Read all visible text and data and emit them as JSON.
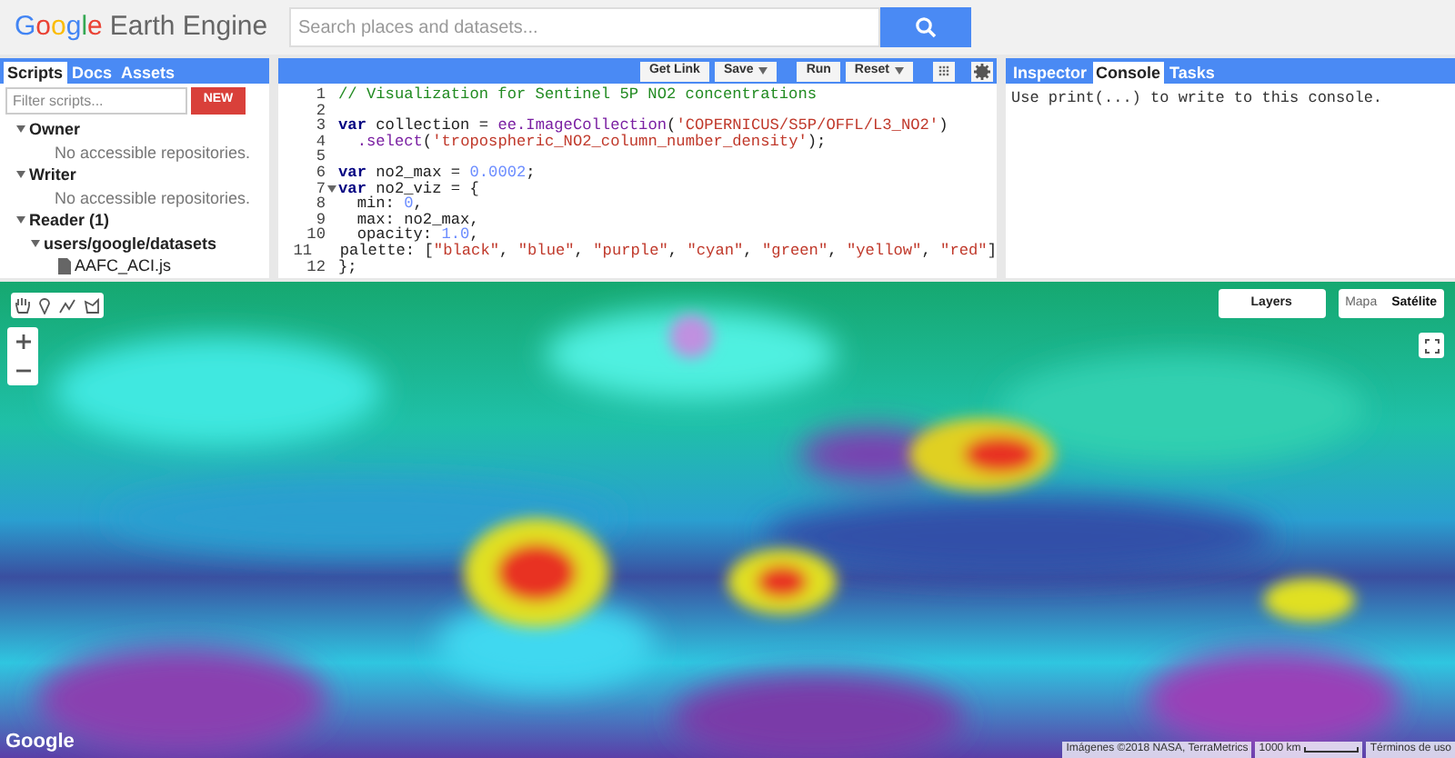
{
  "header": {
    "logo_google": "Google",
    "logo_product": "Earth Engine",
    "search": {
      "placeholder": "Search places and datasets..."
    }
  },
  "left_panel": {
    "tabs": [
      {
        "label": "Scripts",
        "selected": true
      },
      {
        "label": "Docs",
        "selected": false
      },
      {
        "label": "Assets",
        "selected": false
      }
    ],
    "filter": {
      "placeholder": "Filter scripts..."
    },
    "new_button": "NEW",
    "tree": [
      {
        "kind": "folder",
        "label": "Owner",
        "expanded": true,
        "children": [
          {
            "kind": "note",
            "label": "No accessible repositories."
          }
        ]
      },
      {
        "kind": "folder",
        "label": "Writer",
        "expanded": true,
        "children": [
          {
            "kind": "note",
            "label": "No accessible repositories."
          }
        ]
      },
      {
        "kind": "folder",
        "label": "Reader (1)",
        "expanded": true,
        "children": [
          {
            "kind": "folder",
            "label": "users/google/datasets",
            "expanded": true,
            "children": [
              {
                "kind": "file",
                "label": "AAFC_ACI.js"
              }
            ]
          }
        ]
      }
    ]
  },
  "editor": {
    "toolbar": [
      {
        "label": "Get Link",
        "menu": false
      },
      {
        "label": "Save",
        "menu": true
      },
      {
        "label": "Run",
        "menu": false
      },
      {
        "label": "Reset",
        "menu": true
      }
    ],
    "lines": [
      {
        "number": "1",
        "fold": false,
        "tokens": [
          {
            "kind": "comment",
            "text": "// Visualization for Sentinel 5P NO2 concentrations"
          }
        ]
      },
      {
        "number": "2",
        "fold": false
      },
      {
        "number": "3",
        "fold": false,
        "tokens": [
          {
            "kind": "keyword",
            "text": "var"
          },
          {
            "kind": "plain",
            "text": " collection = "
          },
          {
            "kind": "call",
            "text": "ee.ImageCollection"
          },
          {
            "kind": "plain",
            "text": "("
          },
          {
            "kind": "string",
            "text": "'COPERNICUS/S5P/OFFL/L3_NO2'"
          },
          {
            "kind": "plain",
            "text": ")"
          }
        ]
      },
      {
        "number": "4",
        "fold": false,
        "tokens": [
          {
            "kind": "call",
            "text": "  .select"
          },
          {
            "kind": "plain",
            "text": "("
          },
          {
            "kind": "string",
            "text": "'tropospheric_NO2_column_number_density'"
          },
          {
            "kind": "plain",
            "text": ");"
          }
        ]
      },
      {
        "number": "5",
        "fold": false
      },
      {
        "number": "6",
        "fold": false,
        "tokens": [
          {
            "kind": "keyword",
            "text": "var"
          },
          {
            "kind": "plain",
            "text": " no2_max = "
          },
          {
            "kind": "number",
            "text": "0.0002"
          },
          {
            "kind": "plain",
            "text": ";"
          }
        ]
      },
      {
        "number": "7",
        "fold": true,
        "tokens": [
          {
            "kind": "keyword",
            "text": "var"
          },
          {
            "kind": "plain",
            "text": " no2_viz = {"
          }
        ]
      },
      {
        "number": "8",
        "fold": false,
        "tokens": [
          {
            "kind": "plain",
            "text": "  min: "
          },
          {
            "kind": "number",
            "text": "0"
          },
          {
            "kind": "plain",
            "text": ","
          }
        ]
      },
      {
        "number": "9",
        "fold": false,
        "tokens": [
          {
            "kind": "plain",
            "text": "  max: no2_max,"
          }
        ]
      },
      {
        "number": "10",
        "fold": false,
        "tokens": [
          {
            "kind": "plain",
            "text": "  opacity: "
          },
          {
            "kind": "number",
            "text": "1.0"
          },
          {
            "kind": "plain",
            "text": ","
          }
        ]
      },
      {
        "number": "11",
        "fold": false,
        "tokens": [
          {
            "kind": "plain",
            "text": "  palette: ["
          },
          {
            "kind": "string",
            "text": "\"black\""
          },
          {
            "kind": "plain",
            "text": ", "
          },
          {
            "kind": "string",
            "text": "\"blue\""
          },
          {
            "kind": "plain",
            "text": ", "
          },
          {
            "kind": "string",
            "text": "\"purple\""
          },
          {
            "kind": "plain",
            "text": ", "
          },
          {
            "kind": "string",
            "text": "\"cyan\""
          },
          {
            "kind": "plain",
            "text": ", "
          },
          {
            "kind": "string",
            "text": "\"green\""
          },
          {
            "kind": "plain",
            "text": ", "
          },
          {
            "kind": "string",
            "text": "\"yellow\""
          },
          {
            "kind": "plain",
            "text": ", "
          },
          {
            "kind": "string",
            "text": "\"red\""
          },
          {
            "kind": "plain",
            "text": "]"
          }
        ]
      },
      {
        "number": "12",
        "fold": false,
        "tokens": [
          {
            "kind": "plain",
            "text": "};"
          }
        ]
      }
    ]
  },
  "right_panel": {
    "tabs": [
      {
        "label": "Inspector",
        "selected": false
      },
      {
        "label": "Console",
        "selected": true
      },
      {
        "label": "Tasks",
        "selected": false
      }
    ],
    "console_text": "Use print(...) to write to this console."
  },
  "map": {
    "layers_button": "Layers",
    "map_types": [
      {
        "label": "Mapa",
        "selected": false
      },
      {
        "label": "Satélite",
        "selected": true
      }
    ],
    "logo": "Google",
    "attribution": "Imágenes ©2018 NASA, TerraMetrics",
    "scale": "1000 km",
    "terms": "Términos de uso"
  }
}
